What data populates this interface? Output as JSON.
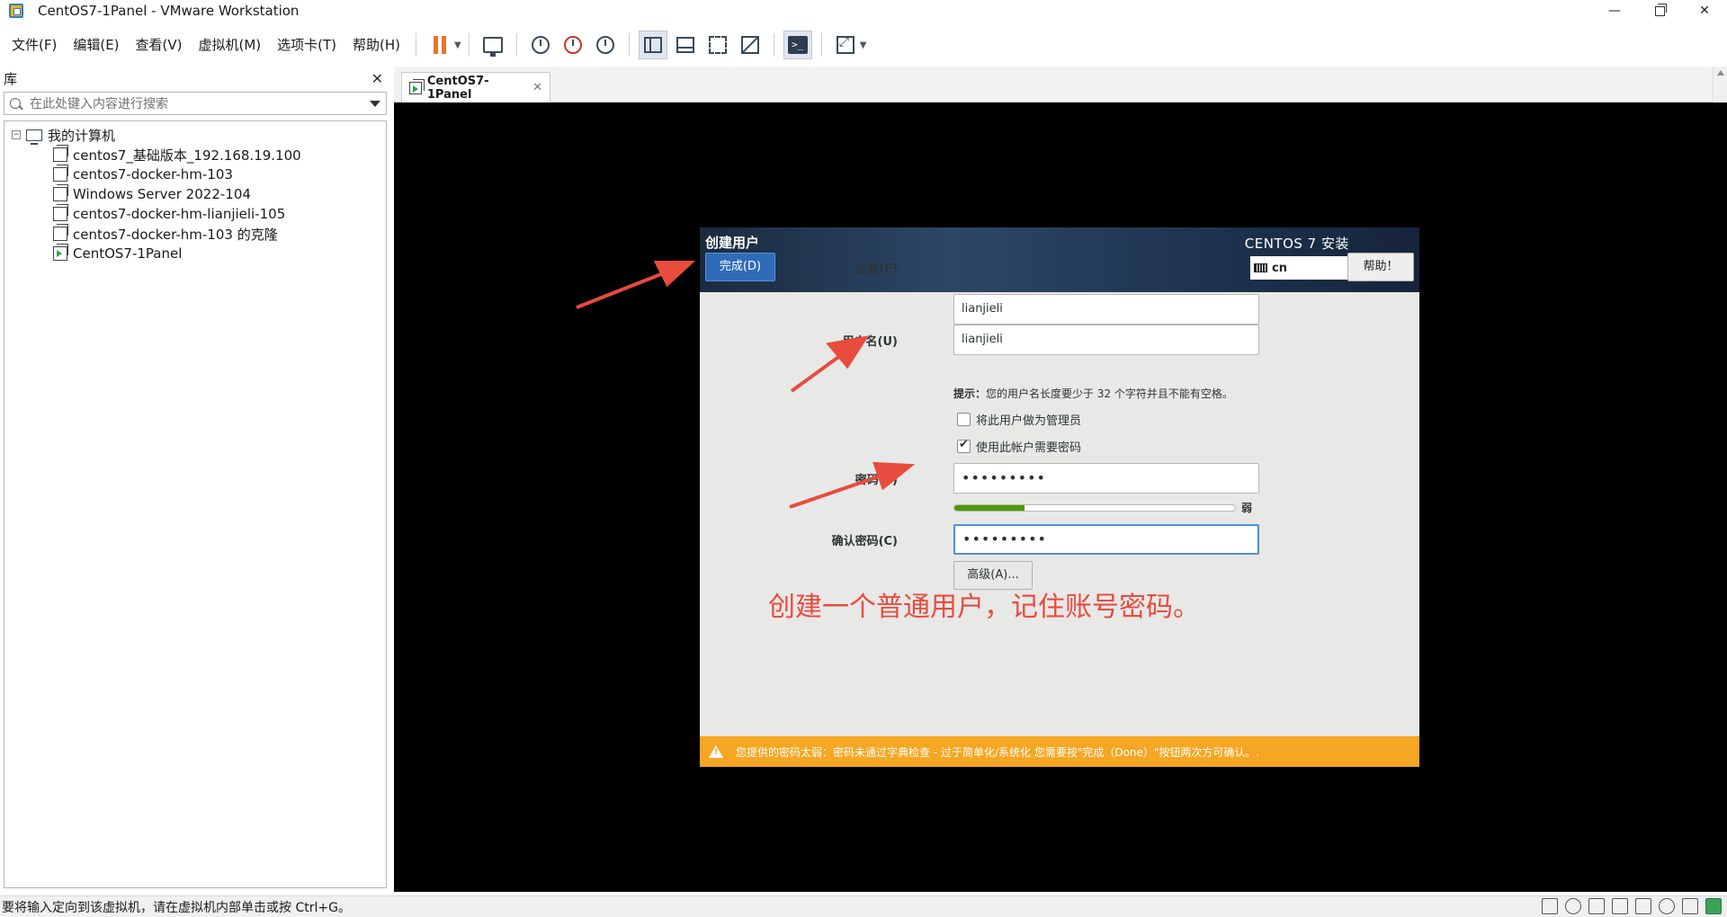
{
  "window": {
    "title": "CentOS7-1Panel - VMware Workstation",
    "minimize": "—",
    "close": "✕"
  },
  "menu": [
    "文件(F)",
    "编辑(E)",
    "查看(V)",
    "虚拟机(M)",
    "选项卡(T)",
    "帮助(H)"
  ],
  "library": {
    "title": "库",
    "close": "✕",
    "search_placeholder": "在此处键入内容进行搜索",
    "root_label": "我的计算机",
    "expander": "−",
    "vms": [
      "centos7_基础版本_192.168.19.100",
      "centos7-docker-hm-103",
      "Windows Server 2022-104",
      "centos7-docker-hm-lianjieli-105",
      "centos7-docker-hm-103 的克隆",
      "CentOS7-1Panel"
    ]
  },
  "tab": {
    "label": "CentOS7-1Panel",
    "close": "✕"
  },
  "installer": {
    "title": "创建用户",
    "done_button": "完成(D)",
    "product": "CENTOS 7 安装",
    "keyboard_layout": "cn",
    "help_button": "帮助！",
    "fullname_label": "全名(F)",
    "fullname_value": "lianjieli",
    "username_label": "用户名(U)",
    "username_value": "lianjieli",
    "hint_prefix": "提示：",
    "hint_text": "您的用户名长度要少于 32 个字符并且不能有空格。",
    "admin_checkbox_label": "将此用户做为管理员",
    "admin_checked": false,
    "password_required_label": "使用此帐户需要密码",
    "password_required_checked": true,
    "password_label": "密码(P)",
    "password_value": "•••••••••",
    "strength_label": "弱",
    "strength_fraction": 0.25,
    "confirm_label": "确认密码(C)",
    "confirm_value": "•••••••••",
    "advanced_button": "高级(A)...",
    "warning": "您提供的密码太弱：密码未通过字典检查 - 过于简单化/系统化 您需要按\"完成（Done）\"按钮两次方可确认。."
  },
  "annotation": {
    "text": "创建一个普通用户，记住账号密码。",
    "color": "#e74c3c"
  },
  "statusbar": {
    "text": "要将输入定向到该虚拟机，请在虚拟机内部单击或按 Ctrl+G。"
  },
  "colors": {
    "done_button": "#2f6cb8",
    "warning_bar": "#f5a623",
    "strength_fill": "#4e9a06",
    "focus_border": "#4a90d9"
  }
}
